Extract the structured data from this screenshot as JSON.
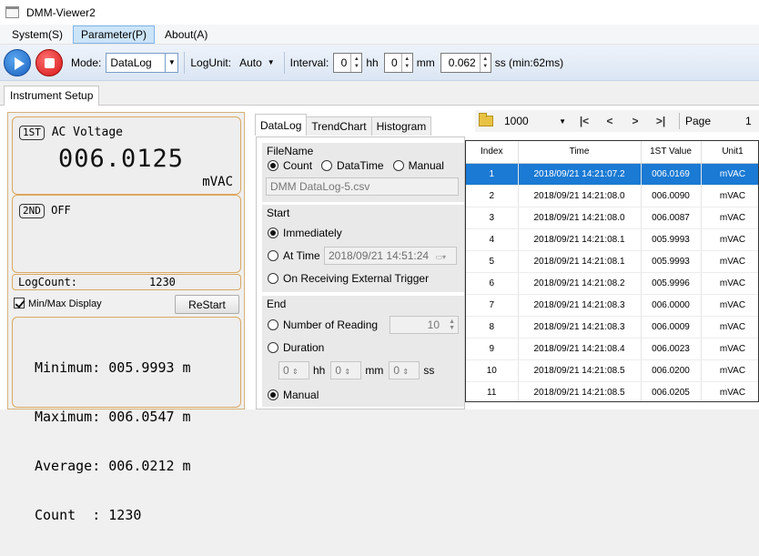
{
  "window": {
    "title": "DMM-Viewer2"
  },
  "menu": [
    {
      "label": "System(S)",
      "active": false
    },
    {
      "label": "Parameter(P)",
      "active": true
    },
    {
      "label": "About(A)",
      "active": false
    }
  ],
  "toolbar": {
    "mode_label": "Mode:",
    "mode_value": "DataLog",
    "logunit_label": "LogUnit:",
    "logunit_value": "Auto",
    "interval_label": "Interval:",
    "hh_value": "0",
    "hh_unit": "hh",
    "mm_value": "0",
    "mm_unit": "mm",
    "ss_value": "0.062",
    "ss_unit": "ss (min:62ms)"
  },
  "main_tab": "Instrument Setup",
  "display": {
    "first_tag": "1ST",
    "first_function": "AC Voltage",
    "first_reading": "006.0125",
    "first_unit": "mVAC",
    "second_tag": "2ND",
    "second_status": "OFF",
    "logcount_label": "LogCount:",
    "logcount_value": "1230",
    "minmax_label": "Min/Max Display",
    "minmax_checked": true,
    "restart_label": "ReStart",
    "minimum": "Minimum: 005.9993 m",
    "maximum": "Maximum: 006.0547 m",
    "average": "Average: 006.0212 m",
    "count": "Count  : 1230"
  },
  "subtabs": [
    "DataLog",
    "TrendChart",
    "Histogram"
  ],
  "nav": {
    "pagesize": "1000",
    "first": "|<",
    "prev": "<",
    "next": ">",
    "last": ">|",
    "page_label": "Page",
    "page_value": "1"
  },
  "form": {
    "filename_header": "FileName",
    "count_label": "Count",
    "datatime_label": "DataTime",
    "manual_label": "Manual",
    "filename_value": "DMM DataLog-5.csv",
    "start_header": "Start",
    "immediately_label": "Immediately",
    "attime_label": "At Time",
    "attime_value": "2018/09/21 14:51:24",
    "trigger_label": "On Receiving External Trigger",
    "end_header": "End",
    "numreading_label": "Number of Reading",
    "numreading_value": "10",
    "duration_label": "Duration",
    "dur_hh": "0",
    "dur_hh_unit": "hh",
    "dur_mm": "0",
    "dur_mm_unit": "mm",
    "dur_ss": "0",
    "dur_ss_unit": "ss",
    "end_manual_label": "Manual"
  },
  "table": {
    "headers": [
      "Index",
      "Time",
      "1ST Value",
      "Unit1"
    ],
    "rows": [
      [
        "1",
        "2018/09/21 14:21:07.2",
        "006.0169",
        "mVAC"
      ],
      [
        "2",
        "2018/09/21 14:21:08.0",
        "006.0090",
        "mVAC"
      ],
      [
        "3",
        "2018/09/21 14:21:08.0",
        "006.0087",
        "mVAC"
      ],
      [
        "4",
        "2018/09/21 14:21:08.1",
        "005.9993",
        "mVAC"
      ],
      [
        "5",
        "2018/09/21 14:21:08.1",
        "005.9993",
        "mVAC"
      ],
      [
        "6",
        "2018/09/21 14:21:08.2",
        "005.9996",
        "mVAC"
      ],
      [
        "7",
        "2018/09/21 14:21:08.3",
        "006.0000",
        "mVAC"
      ],
      [
        "8",
        "2018/09/21 14:21:08.3",
        "006.0009",
        "mVAC"
      ],
      [
        "9",
        "2018/09/21 14:21:08.4",
        "006.0023",
        "mVAC"
      ],
      [
        "10",
        "2018/09/21 14:21:08.5",
        "006.0200",
        "mVAC"
      ],
      [
        "11",
        "2018/09/21 14:21:08.5",
        "006.0205",
        "mVAC"
      ]
    ],
    "selected_row": 0
  }
}
